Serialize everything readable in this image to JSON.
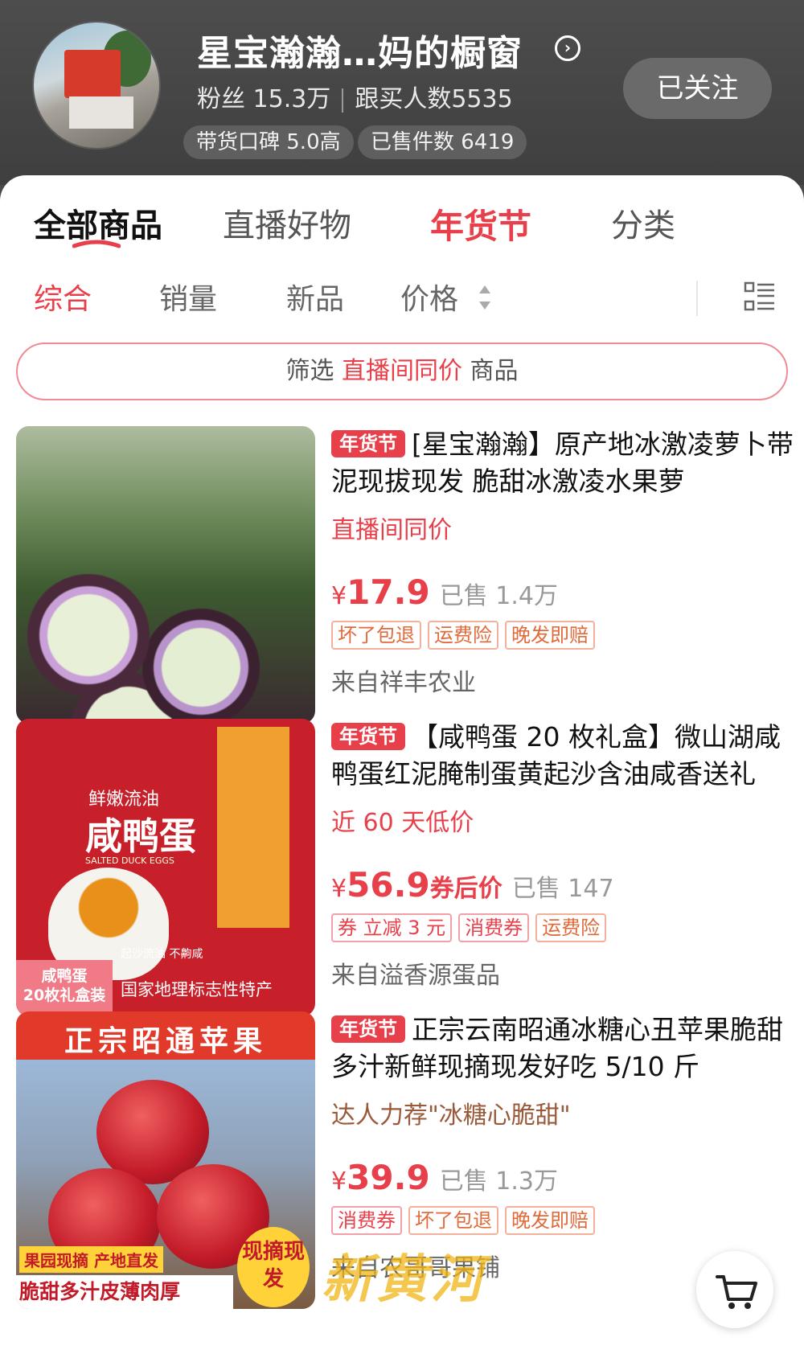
{
  "header": {
    "shop_name": "星宝瀚瀚…妈的橱窗",
    "followers_label": "粉丝 15.3万",
    "buyers_label": "跟买人数5535",
    "rating_pill": "带货口碑 5.0高",
    "sold_pill": "已售件数 6419",
    "follow_button": "已关注"
  },
  "tabs": [
    "全部商品",
    "直播好物",
    "年货节",
    "分类"
  ],
  "sort": [
    "综合",
    "销量",
    "新品",
    "价格"
  ],
  "filter": {
    "prefix": "筛选 ",
    "highlight": "直播间同价",
    "suffix": " 商品"
  },
  "products": [
    {
      "tag": "年货节",
      "title": "[星宝瀚瀚】原产地冰激凌萝卜带泥现拔现发 脆甜冰激凌水果萝",
      "subtitle": "直播间同价",
      "yen": "¥",
      "price": "17.9",
      "price_suffix": "",
      "sold": "已售 1.4万",
      "badges": [
        "坏了包退",
        "运费险",
        "晚发即赔"
      ],
      "store": "来自祥丰农业"
    },
    {
      "tag": "年货节",
      "title": "【咸鸭蛋 20 枚礼盒】微山湖咸鸭蛋红泥腌制蛋黄起沙含油咸香送礼",
      "subtitle": "近 60 天低价",
      "yen": "¥",
      "price": "56.9",
      "price_suffix": "券后价",
      "sold": "已售 147",
      "badges": [
        "券 立减 3 元",
        "消费券",
        "运费险"
      ],
      "store": "来自溢香源蛋品",
      "thumb_text": {
        "brand_line": "鲜嫩流油",
        "product_name": "咸鸭蛋",
        "english": "SALTED DUCK EGGS",
        "box_label": "咸鸭蛋\n20枚礼盒装",
        "bottom": "国家地理标志性特产",
        "small": "起沙流油 不齁咸"
      }
    },
    {
      "tag": "年货节",
      "title": "正宗云南昭通冰糖心丑苹果脆甜多汁新鲜现摘现发好吃 5/10 斤",
      "subtitle": "达人力荐\"冰糖心脆甜\"",
      "yen": "¥",
      "price": "39.9",
      "price_suffix": "",
      "sold": "已售 1.3万",
      "badges": [
        "消费券",
        "坏了包退",
        "晚发即赔"
      ],
      "store": "来自农哥哥果铺",
      "thumb_text": {
        "banner": "正宗昭通苹果",
        "left_tag": "果园现摘 产地直发",
        "bottom": "脆甜多汁皮薄肉厚",
        "corner": "现摘现发"
      }
    }
  ],
  "watermark": "新黄河",
  "colors": {
    "accent": "#e8404b",
    "header_bg": "#454545"
  },
  "icons": {
    "cart": "shopping-cart-icon",
    "chevron": "chevron-right-icon",
    "grid": "list-view-icon"
  }
}
